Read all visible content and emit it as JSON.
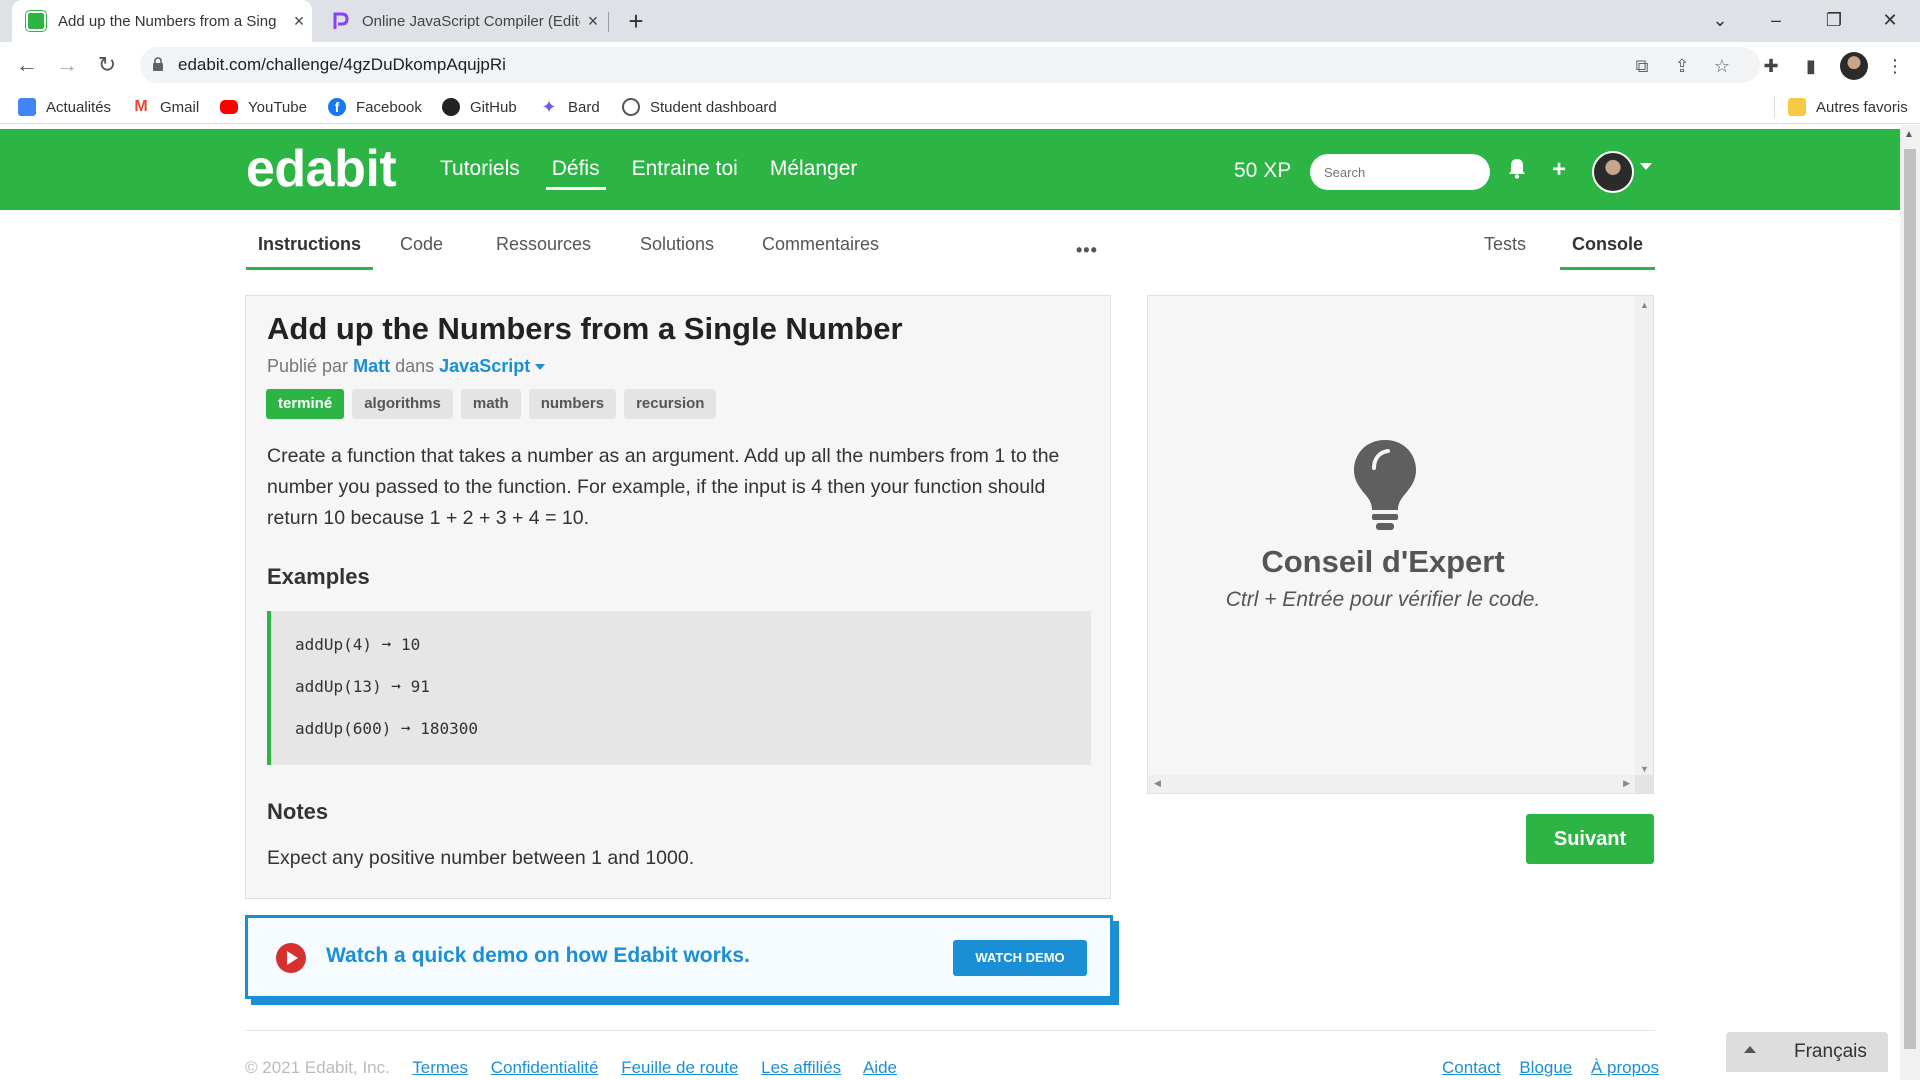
{
  "browser": {
    "tabs": [
      {
        "title": "Add up the Numbers from a Sing",
        "active": true
      },
      {
        "title": "Online JavaScript Compiler (Edito",
        "active": false
      }
    ],
    "url": "edabit.com/challenge/4gzDuDkompAqujpRi",
    "bookmarks": [
      "Actualités",
      "Gmail",
      "YouTube",
      "Facebook",
      "GitHub",
      "Bard",
      "Student dashboard"
    ],
    "other_bookmarks": "Autres favoris"
  },
  "site": {
    "logo": "edabit",
    "nav": [
      "Tutoriels",
      "Défis",
      "Entraine toi",
      "Mélanger"
    ],
    "active_nav": "Défis",
    "xp": "50 XP",
    "search_placeholder": "Search",
    "accent_color": "#2cb544",
    "link_color": "#1a8fd6"
  },
  "subtabs": {
    "left": [
      "Instructions",
      "Code",
      "Ressources",
      "Solutions",
      "Commentaires"
    ],
    "more": "•••",
    "right": [
      "Tests",
      "Console"
    ]
  },
  "challenge": {
    "title": "Add up the Numbers from a Single Number",
    "meta_prefix": "Publié par",
    "author": "Matt",
    "meta_mid": "dans",
    "language": "JavaScript",
    "tags": [
      "terminé",
      "algorithms",
      "math",
      "numbers",
      "recursion"
    ],
    "description": "Create a function that takes a number as an argument. Add up all the numbers from 1 to the number you passed to the function. For example, if the input is 4 then your function should return 10 because 1 + 2 + 3 + 4 = 10.",
    "examples_heading": "Examples",
    "examples": [
      "addUp(4) ➞ 10",
      "addUp(13) ➞ 91",
      "addUp(600) ➞ 180300"
    ],
    "notes_heading": "Notes",
    "notes": "Expect any positive number between 1 and 1000."
  },
  "console": {
    "title": "Conseil d'Expert",
    "subtitle": "Ctrl + Entrée pour vérifier le code."
  },
  "next_button": "Suivant",
  "demo": {
    "text": "Watch a quick demo on how Edabit works.",
    "button": "WATCH DEMO"
  },
  "footer": {
    "copyright": "© 2021 Edabit, Inc.",
    "links_left": [
      "Termes",
      "Confidentialité",
      "Feuille de route",
      "Les affiliés",
      "Aide"
    ],
    "links_right": [
      "Contact",
      "Blogue",
      "À propos"
    ],
    "language": "Français"
  }
}
